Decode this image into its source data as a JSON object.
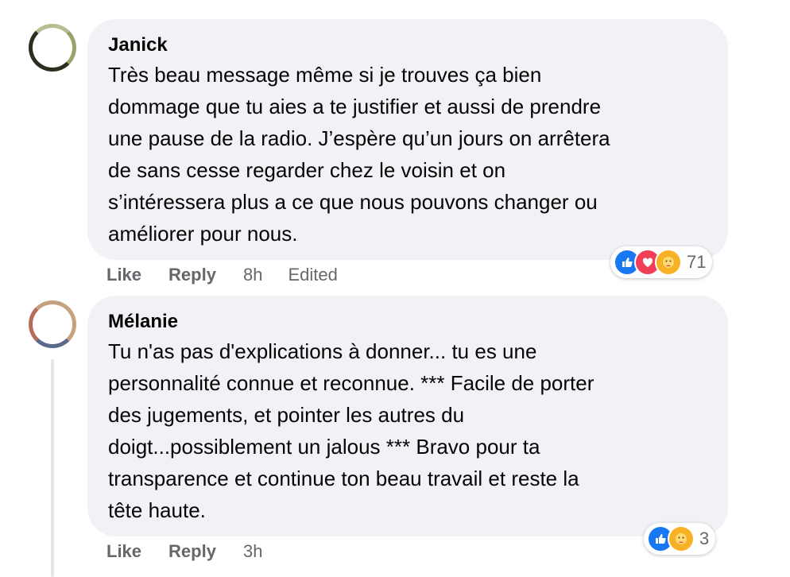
{
  "comments": [
    {
      "author": "Janick",
      "text": "Très beau message même si je trouves ça bien\ndommage que tu aies a te justifier et aussi de prendre\nune pause de la radio. J’espère qu’un jours on arrêtera\nde sans cesse regarder chez le voisin et on\ns’intéressera plus a ce que nous pouvons changer ou\naméliorer pour nous.",
      "like_label": "Like",
      "reply_label": "Reply",
      "time": "8h",
      "edited": "Edited",
      "reaction_count": "71",
      "reaction_icons": [
        "like-icon",
        "love-icon",
        "care-icon"
      ]
    },
    {
      "author": "Mélanie",
      "text": "Tu n'as pas d'explications à donner... tu es une\npersonnalité connue et reconnue. *** Facile de porter\ndes jugements, et pointer les autres du\ndoigt...possiblement un jalous *** Bravo pour ta\ntransparence et continue ton beau travail et reste la\ntête haute.",
      "like_label": "Like",
      "reply_label": "Reply",
      "time": "3h",
      "reaction_count": "3",
      "reaction_icons": [
        "like-icon",
        "care-icon"
      ]
    }
  ],
  "colors": {
    "bubble": "#f0f2f5",
    "secondary_text": "#65676b",
    "like_blue": "#1877f2",
    "love_red": "#f33e58",
    "care_yellow": "#f7b125"
  }
}
